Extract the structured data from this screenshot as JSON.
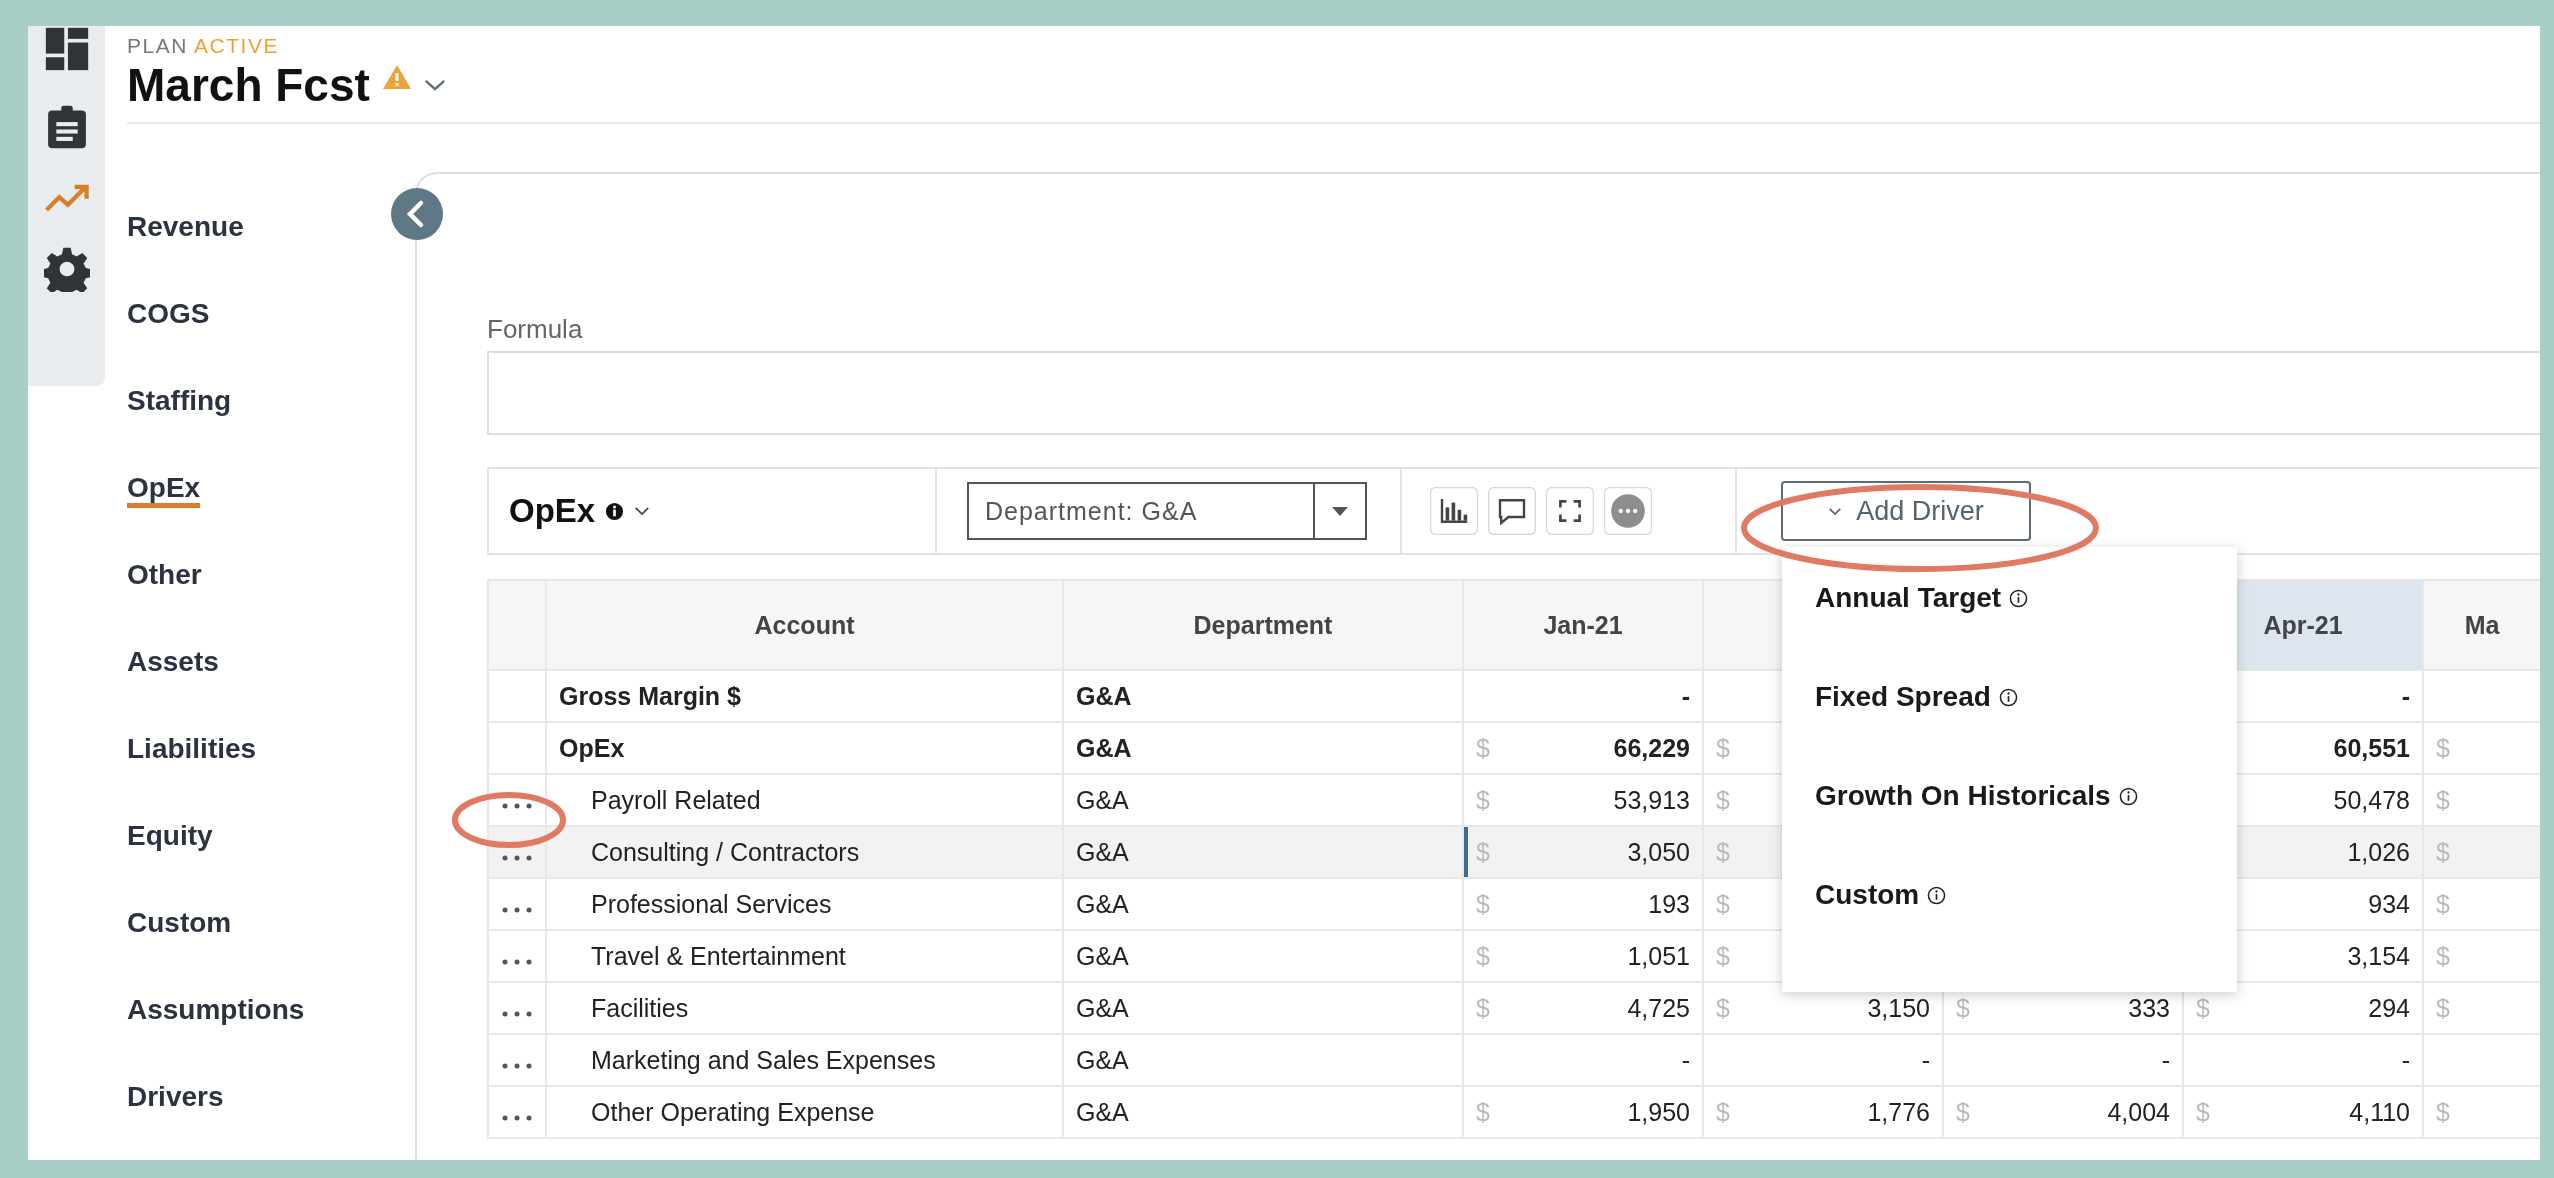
{
  "rail_items": [
    {
      "selected": false
    },
    {
      "selected": false
    },
    {
      "selected": true
    },
    {
      "selected": false
    }
  ],
  "header": {
    "plan_label": "PLAN",
    "plan_status": "ACTIVE",
    "title": "March Fcst",
    "warning": true
  },
  "nav": [
    {
      "label": "Revenue",
      "selected": false
    },
    {
      "label": "COGS",
      "selected": false
    },
    {
      "label": "Staffing",
      "selected": false
    },
    {
      "label": "OpEx",
      "selected": true
    },
    {
      "label": "Other",
      "selected": false
    },
    {
      "label": "Assets",
      "selected": false
    },
    {
      "label": "Liabilities",
      "selected": false
    },
    {
      "label": "Equity",
      "selected": false
    },
    {
      "label": "Custom",
      "selected": false
    },
    {
      "label": "Assumptions",
      "selected": false
    },
    {
      "label": "Drivers",
      "selected": false
    }
  ],
  "formula": {
    "label": "Formula"
  },
  "toolbar": {
    "section": "OpEx",
    "filter": "Department: G&A",
    "add_driver": "Add Driver"
  },
  "driver_menu": [
    "Annual Target",
    "Fixed Spread",
    "Growth On Historicals",
    "Custom"
  ],
  "table": {
    "columns": [
      {
        "highlighted": false
      },
      {
        "label": "Account",
        "highlighted": false
      },
      {
        "label": "Department",
        "highlighted": false
      },
      {
        "label": "Jan-21",
        "highlighted": false
      },
      null,
      null,
      {
        "label": "Apr-21",
        "highlighted": true
      },
      {
        "label": "Ma",
        "highlighted": false
      }
    ],
    "rows": [
      {
        "kind": "group",
        "selected": false,
        "cells": [
          "",
          "Gross Margin $",
          "G&A",
          {
            "value": "-"
          },
          "",
          "",
          {
            "value": "-"
          },
          ""
        ]
      },
      {
        "kind": "group",
        "selected": false,
        "cells": [
          "",
          "OpEx",
          "G&A",
          {
            "sign": "$",
            "value": "66,229"
          },
          {
            "sign": "$"
          },
          "",
          {
            "value": "60,551"
          },
          {
            "sign": "$"
          }
        ]
      },
      {
        "kind": "account",
        "selected": false,
        "cells": [
          "",
          "Payroll Related",
          "G&A",
          {
            "sign": "$",
            "value": "53,913"
          },
          {
            "sign": "$"
          },
          "",
          {
            "value": "50,478"
          },
          {
            "sign": "$"
          }
        ]
      },
      {
        "kind": "account",
        "selected": true,
        "cells": [
          "",
          "Consulting / Contractors",
          "G&A",
          {
            "sign": "$",
            "value": "3,050"
          },
          {
            "sign": "$"
          },
          "",
          {
            "value": "1,026"
          },
          {
            "sign": "$"
          }
        ]
      },
      {
        "kind": "account",
        "selected": false,
        "cells": [
          "",
          "Professional Services",
          "G&A",
          {
            "sign": "$",
            "value": "193"
          },
          {
            "sign": "$"
          },
          "",
          {
            "value": "934"
          },
          {
            "sign": "$"
          }
        ]
      },
      {
        "kind": "account",
        "selected": false,
        "cells": [
          "",
          "Travel & Entertainment",
          "G&A",
          {
            "sign": "$",
            "value": "1,051"
          },
          {
            "sign": "$"
          },
          "",
          {
            "value": "3,154"
          },
          {
            "sign": "$"
          }
        ]
      },
      {
        "kind": "account",
        "selected": false,
        "cells": [
          "",
          "Facilities",
          "G&A",
          {
            "sign": "$",
            "value": "4,725"
          },
          {
            "sign": "$",
            "value": "3,150"
          },
          {
            "sign": "$",
            "value": "333"
          },
          {
            "sign": "$",
            "value": "294"
          },
          {
            "sign": "$"
          }
        ]
      },
      {
        "kind": "account",
        "selected": false,
        "cells": [
          "",
          "Marketing and Sales Expenses",
          "G&A",
          {
            "value": "-"
          },
          {
            "value": "-"
          },
          {
            "value": "-"
          },
          {
            "value": "-"
          },
          ""
        ]
      },
      {
        "kind": "account",
        "selected": false,
        "cells": [
          "",
          "Other Operating Expense",
          "G&A",
          {
            "sign": "$",
            "value": "1,950"
          },
          {
            "sign": "$",
            "value": "1,776"
          },
          {
            "sign": "$",
            "value": "4,004"
          },
          {
            "sign": "$",
            "value": "4,110"
          },
          {
            "sign": "$"
          }
        ]
      }
    ]
  }
}
